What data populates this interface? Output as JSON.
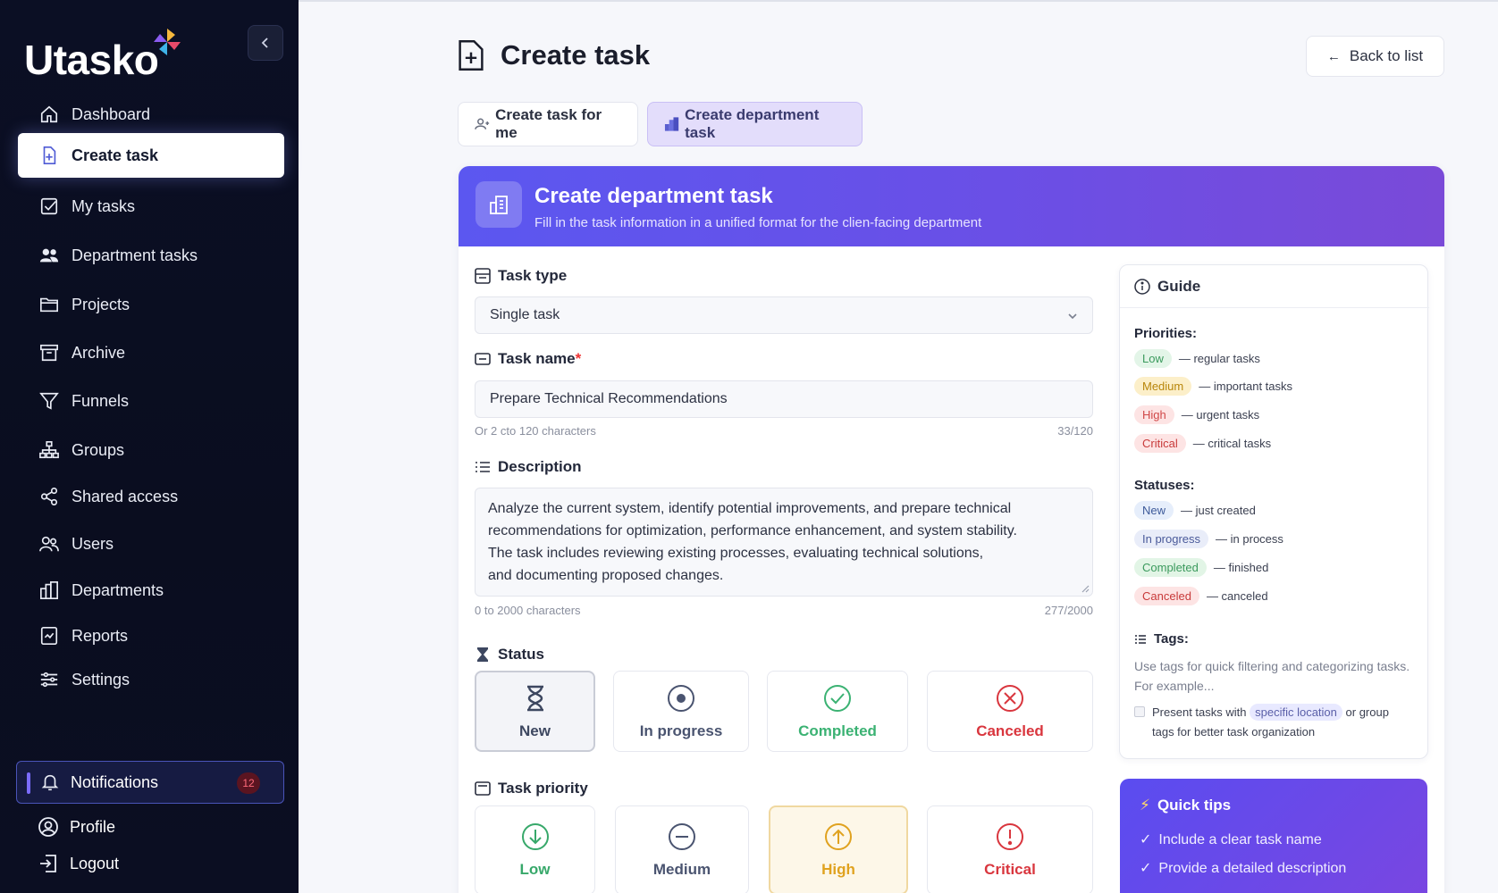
{
  "app": {
    "logo": "Utasko"
  },
  "sidebar": {
    "items": [
      {
        "label": "Dashboard",
        "icon": "home-icon"
      },
      {
        "label": "Create task",
        "icon": "file-plus-icon",
        "active": true
      },
      {
        "label": "My tasks",
        "icon": "checkbox-icon"
      },
      {
        "label": "Department tasks",
        "icon": "users-icon"
      },
      {
        "label": "Projects",
        "icon": "folder-icon"
      },
      {
        "label": "Archive",
        "icon": "archive-icon"
      },
      {
        "label": "Funnels",
        "icon": "funnel-icon"
      },
      {
        "label": "Groups",
        "icon": "hierarchy-icon"
      },
      {
        "label": "Shared access",
        "icon": "share-icon"
      },
      {
        "label": "Users",
        "icon": "users-outline-icon"
      },
      {
        "label": "Departments",
        "icon": "building-icon"
      },
      {
        "label": "Reports",
        "icon": "report-icon"
      },
      {
        "label": "Settings",
        "icon": "sliders-icon"
      }
    ],
    "notifications": {
      "label": "Notifications",
      "count": "12"
    },
    "profile": "Profile",
    "logout": "Logout"
  },
  "header": {
    "title": "Create task",
    "back": "Back to list"
  },
  "tabs": [
    {
      "label": "Create task for me",
      "active": false
    },
    {
      "label": "Create department task",
      "active": true
    }
  ],
  "banner": {
    "title": "Create department task",
    "subtitle": "Fill in the task information in a unified format for the clien‑facing department"
  },
  "form": {
    "task_type": {
      "label": "Task type",
      "value": "Single task"
    },
    "task_name": {
      "label": "Task name",
      "required": "*",
      "value": "Prepare Technical Recommendations",
      "hint": "Or 2 cto 120 characters",
      "count": "33/120"
    },
    "description": {
      "label": "Description",
      "lines": [
        "Analyze the current system, identify potential improvements, and prepare technical",
        "recommendations for optimization, performance enhancement, and system stability.",
        "The task includes reviewing existing processes, evaluating technical solutions,",
        "and documenting proposed changes."
      ],
      "hint": "0 to 2000 characters",
      "count": "277/2000"
    },
    "status": {
      "label": "Status",
      "options": [
        {
          "label": "New",
          "color": "#3d4760",
          "selected": true
        },
        {
          "label": "In progress",
          "color": "#4a5470"
        },
        {
          "label": "Completed",
          "color": "#3bb273"
        },
        {
          "label": "Canceled",
          "color": "#d9363e"
        }
      ]
    },
    "priority": {
      "label": "Task priority",
      "options": [
        {
          "label": "Low",
          "color": "#37a86a"
        },
        {
          "label": "Medium",
          "color": "#4a5470"
        },
        {
          "label": "High",
          "color": "#e0a21f",
          "selected": true
        },
        {
          "label": "Critical",
          "color": "#d9363e"
        }
      ]
    }
  },
  "guide": {
    "title": "Guide",
    "priorities_title": "Priorities:",
    "priorities": [
      {
        "tag": "Low",
        "desc": "— regular tasks",
        "bg": "#e3f5e8",
        "fg": "#3b9a5d"
      },
      {
        "tag": "Medium",
        "desc": "— important tasks",
        "bg": "#fcefc9",
        "fg": "#b8860b"
      },
      {
        "tag": "High",
        "desc": "— urgent tasks",
        "bg": "#fde4e4",
        "fg": "#d04848"
      },
      {
        "tag": "Critical",
        "desc": "— critical tasks",
        "bg": "#fde4e4",
        "fg": "#c83a3a"
      }
    ],
    "statuses_title": "Statuses:",
    "statuses": [
      {
        "tag": "New",
        "desc": "— just created",
        "bg": "#e6eefb",
        "fg": "#3d5a9a"
      },
      {
        "tag": "In progress",
        "desc": "— in process",
        "bg": "#e9edf9",
        "fg": "#4a5a9a"
      },
      {
        "tag": "Completed",
        "desc": "— finished",
        "bg": "#e2f5e6",
        "fg": "#3b9a5d"
      },
      {
        "tag": "Canceled",
        "desc": "— canceled",
        "bg": "#fde4e4",
        "fg": "#c83a3a"
      }
    ],
    "tags_title": "Tags:",
    "tags_text": "Use tags for quick filtering and categorizing tasks. For example...",
    "tags_example_pre": "Present tasks with",
    "tags_example_tag": "specific location",
    "tags_example_post": "or group",
    "tags_example_line2": "tags for better task organization"
  },
  "tips": {
    "title": "Quick tips",
    "items": [
      "Include a clear task name",
      "Provide a detailed description"
    ]
  }
}
